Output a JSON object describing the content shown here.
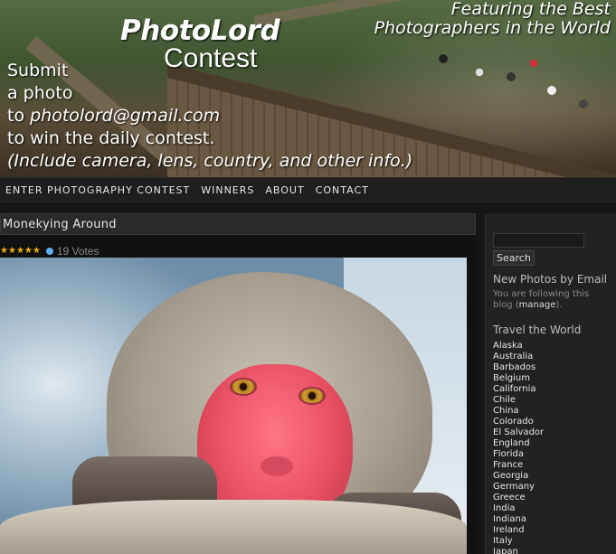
{
  "header": {
    "title": "PhotoLord",
    "subtitle": "Contest",
    "tagline_line1": "Featuring the Best",
    "tagline_line2": "Photographers in the World",
    "submit_lines": [
      "Submit",
      "a photo",
      "to ",
      "photolord@gmail.com",
      "to win the daily contest.",
      "(Include camera, lens, country, and other info.)"
    ]
  },
  "nav": {
    "items": [
      "ENTER PHOTOGRAPHY CONTEST",
      "WINNERS",
      "ABOUT",
      "CONTACT"
    ]
  },
  "post": {
    "title": "Monekying Around",
    "stars": 5,
    "votes": "19 Votes"
  },
  "sidebar": {
    "search_placeholder": "",
    "search_button": "Search",
    "email_heading": "New Photos by Email",
    "email_note_prefix": "You are following this blog (",
    "email_note_link": "manage",
    "email_note_suffix": ").",
    "travel_heading": "Travel the World",
    "travel_items": [
      "Alaska",
      "Australia",
      "Barbados",
      "Belgium",
      "California",
      "Chile",
      "China",
      "Colorado",
      "El Salvador",
      "England",
      "Florida",
      "France",
      "Georgia",
      "Germany",
      "Greece",
      "India",
      "Indiana",
      "Ireland",
      "Italy",
      "Japan"
    ]
  },
  "colors": {
    "page_bg": "#161616",
    "nav_text": "#e8e8e8",
    "star": "#f0b400",
    "info_icon": "#5ab0f0"
  }
}
